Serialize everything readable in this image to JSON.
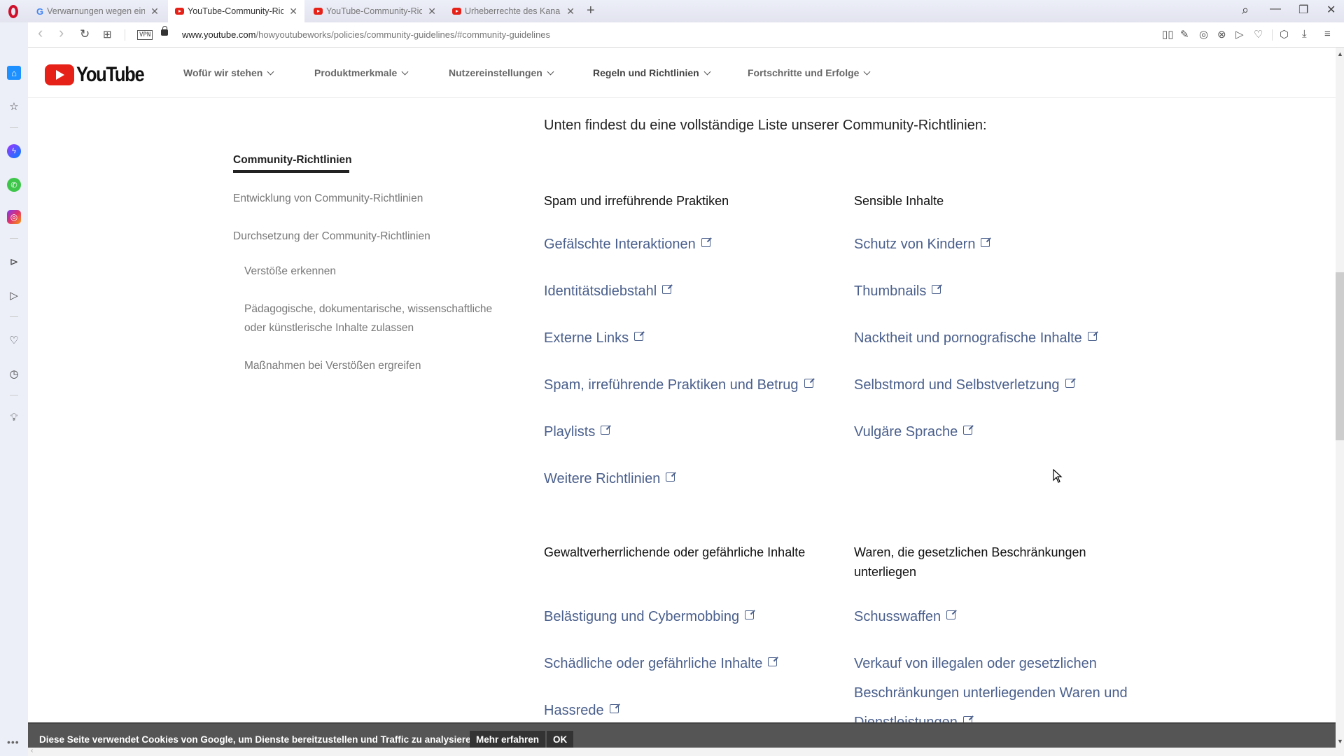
{
  "browser": {
    "tabs": [
      {
        "title": "Verwarnungen wegen eine",
        "favicon": "google",
        "active": false
      },
      {
        "title": "YouTube-Community-Richt",
        "favicon": "youtube",
        "active": true
      },
      {
        "title": "YouTube-Community-Richt",
        "favicon": "youtube",
        "active": false
      },
      {
        "title": "Urheberrechte des Kanals",
        "favicon": "youtube",
        "active": false
      }
    ],
    "close_glyph": "✕",
    "new_tab_glyph": "+",
    "vpn_label": "VPN",
    "url_domain": "www.youtube.com",
    "url_path": "/howyoutubeworks/policies/community-guidelines/#community-guidelines",
    "icons": {
      "back": "‹",
      "forward": "›",
      "reload": "↻",
      "tabs": "⊞",
      "search": "⌕",
      "minimize": "—",
      "restore": "❐",
      "close": "✕",
      "reader": "▯▯",
      "edit": "✎",
      "snapshot": "◎",
      "adblock": "⊗",
      "send": "▷",
      "heart": "♡",
      "box": "⬡",
      "download": "⤓",
      "menu": "≡"
    }
  },
  "opera_sidebar": {
    "items": [
      "home",
      "star",
      "messenger",
      "whatsapp",
      "instagram",
      "player",
      "send",
      "heart",
      "history",
      "tips"
    ],
    "more": "•••"
  },
  "site": {
    "logo_text": "YouTube",
    "nav": [
      {
        "label": "Wofür wir stehen"
      },
      {
        "label": "Produktmerkmale"
      },
      {
        "label": "Nutzereinstellungen"
      },
      {
        "label": "Regeln und Richtlinien",
        "active": true
      },
      {
        "label": "Fortschritte und Erfolge"
      }
    ]
  },
  "left_nav": {
    "active": "Community-Richtlinien",
    "items": [
      "Entwicklung von Community-Richtlinien",
      "Durchsetzung der Community-Richtlinien"
    ],
    "subitems": [
      "Verstöße erkennen",
      "Pädagogische, dokumentarische, wissenschaftliche oder künstlerische Inhalte zulassen",
      "Maßnahmen bei Verstößen ergreifen"
    ]
  },
  "content": {
    "intro": "Unten findest du eine vollständige Liste unserer Community-Richtlinien:",
    "sections": [
      {
        "heading": "Spam und irreführende Praktiken",
        "links": [
          "Gefälschte Interaktionen",
          "Identitätsdiebstahl",
          "Externe Links",
          "Spam, irreführende Praktiken und Betrug",
          "Playlists",
          "Weitere Richtlinien"
        ]
      },
      {
        "heading": "Sensible Inhalte",
        "links": [
          "Schutz von Kindern",
          "Thumbnails",
          "Nacktheit und pornografische Inhalte",
          "Selbstmord und Selbstverletzung",
          "Vulgäre Sprache"
        ]
      },
      {
        "heading": "Gewaltverherrlichende oder gefährliche Inhalte",
        "links": [
          "Belästigung und Cybermobbing",
          "Schädliche oder gefährliche Inhalte",
          "Hassrede"
        ]
      },
      {
        "heading": "Waren, die gesetzlichen Beschränkungen unterliegen",
        "links": [
          "Schusswaffen",
          "Verkauf von illegalen oder gesetzlichen Beschränkungen unterliegenden Waren und Dienstleistungen"
        ]
      }
    ]
  },
  "cookie_bar": {
    "message": "Diese Seite verwendet Cookies von Google, um Dienste bereitzustellen und Traffic zu analysieren.",
    "more_label": "Mehr erfahren",
    "ok_label": "OK"
  },
  "scroll": {
    "vertical_position": 0.42
  },
  "colors": {
    "link": "#4a5f8c",
    "brand": "#e62117",
    "opera": "#d0102b"
  }
}
